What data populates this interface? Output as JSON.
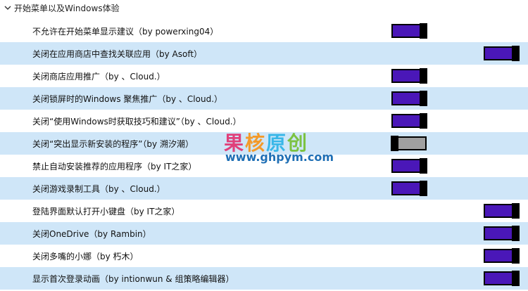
{
  "section": {
    "title": "开始菜单以及Windows体验"
  },
  "colors": {
    "row_alt": "#cfe6f8",
    "toggle_on": "#4a17b8",
    "toggle_off": "#a0a0a0"
  },
  "items": [
    {
      "label": "不允许在开始菜单显示建议（by powerxing04）",
      "on": true
    },
    {
      "label": "关闭在应用商店中查找关联应用（by Asoft）",
      "on": true
    },
    {
      "label": "关闭商店应用推广（by 、Cloud.）",
      "on": true
    },
    {
      "label": "关闭锁屏时的Windows 聚焦推广（by 、Cloud.）",
      "on": true
    },
    {
      "label": "关闭“使用Windows时获取技巧和建议”（by 、Cloud.）",
      "on": true
    },
    {
      "label": "关闭“突出显示新安装的程序”（by 溯汐潮）",
      "on": false
    },
    {
      "label": "禁止自动安装推荐的应用程序（by IT之家）",
      "on": true
    },
    {
      "label": "关闭游戏录制工具（by 、Cloud.）",
      "on": true
    },
    {
      "label": "登陆界面默认打开小键盘（by IT之家）",
      "on": true
    },
    {
      "label": "关闭OneDrive（by Rambin）",
      "on": true
    },
    {
      "label": "关闭多嘴的小娜（by 朽木）",
      "on": true
    },
    {
      "label": "显示首次登录动画（by intionwun & 组策略编辑器）",
      "on": true
    }
  ],
  "watermark": {
    "title": "果核原创",
    "url": "www.ghpym.com"
  }
}
